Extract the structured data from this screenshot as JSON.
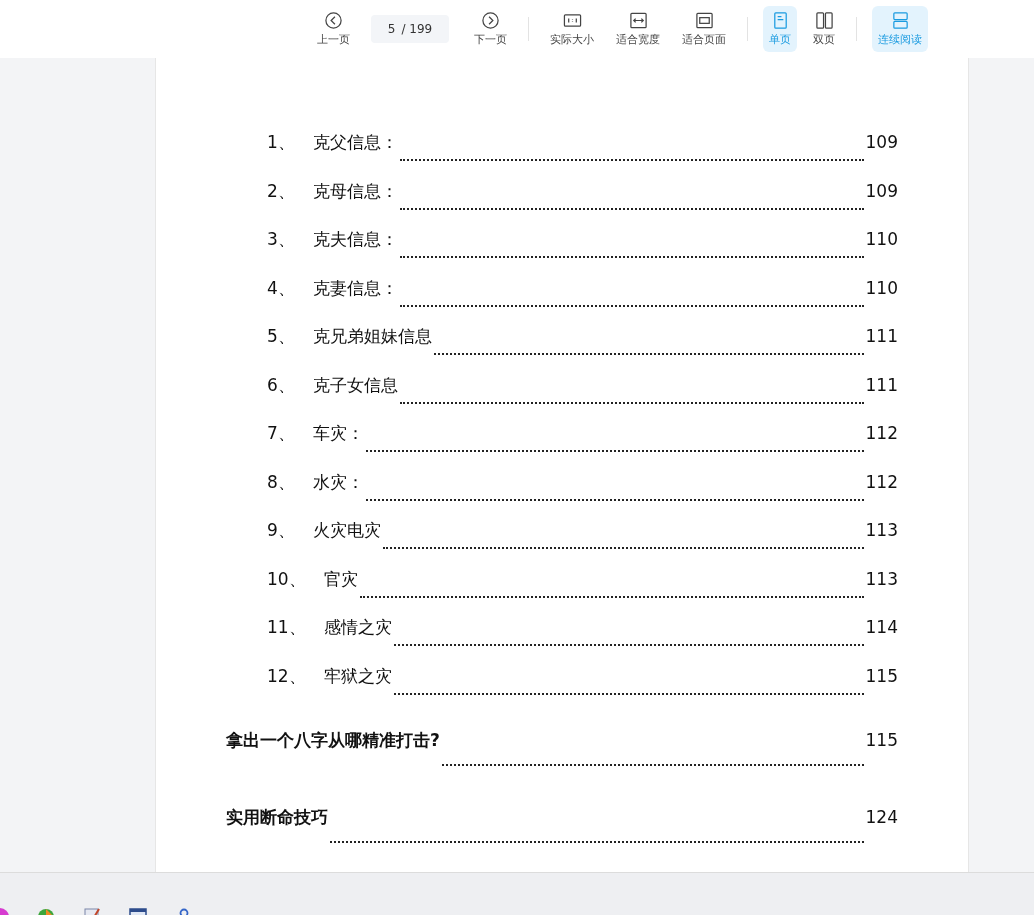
{
  "toolbar": {
    "buttons": [
      {
        "kind": "prev",
        "label": "上一页",
        "selected": false
      },
      {
        "kind": "page",
        "value": "5",
        "total": "/ 199"
      },
      {
        "kind": "next",
        "label": "下一页",
        "selected": false
      },
      {
        "kind": "divider"
      },
      {
        "kind": "actual",
        "label": "实际大小",
        "selected": false
      },
      {
        "kind": "fitwidth",
        "label": "适合宽度",
        "selected": false
      },
      {
        "kind": "fitpage",
        "label": "适合页面",
        "selected": false
      },
      {
        "kind": "divider"
      },
      {
        "kind": "single",
        "label": "单页",
        "selected": true
      },
      {
        "kind": "double",
        "label": "双页",
        "selected": false
      },
      {
        "kind": "divider"
      },
      {
        "kind": "continuous",
        "label": "连续阅读",
        "selected": true
      }
    ]
  },
  "toc": [
    {
      "kind": "sub",
      "number": "1、",
      "title": "克父信息：",
      "page": "109"
    },
    {
      "kind": "sub",
      "number": "2、",
      "title": "克母信息：",
      "page": "109"
    },
    {
      "kind": "sub",
      "number": "3、",
      "title": "克夫信息：",
      "page": "110"
    },
    {
      "kind": "sub",
      "number": "4、",
      "title": "克妻信息：",
      "page": "110"
    },
    {
      "kind": "sub",
      "number": "5、",
      "title": "克兄弟姐妹信息",
      "page": "111"
    },
    {
      "kind": "sub",
      "number": "6、",
      "title": "克子女信息",
      "page": "111"
    },
    {
      "kind": "sub",
      "number": "7、",
      "title": "车灾：",
      "page": "112"
    },
    {
      "kind": "sub",
      "number": "8、",
      "title": "水灾：",
      "page": "112"
    },
    {
      "kind": "sub",
      "number": "9、",
      "title": "火灾电灾",
      "page": "113"
    },
    {
      "kind": "sub",
      "number": "10、",
      "title": "官灾",
      "page": "113"
    },
    {
      "kind": "sub",
      "number": "11、",
      "title": "感情之灾",
      "page": "114"
    },
    {
      "kind": "sub",
      "number": "12、",
      "title": "牢狱之灾",
      "page": "115"
    },
    {
      "kind": "main",
      "title": "拿出一个八字从哪精准打击?",
      "page": "115"
    },
    {
      "kind": "main",
      "title": "实用断命技巧",
      "page": "124"
    }
  ]
}
